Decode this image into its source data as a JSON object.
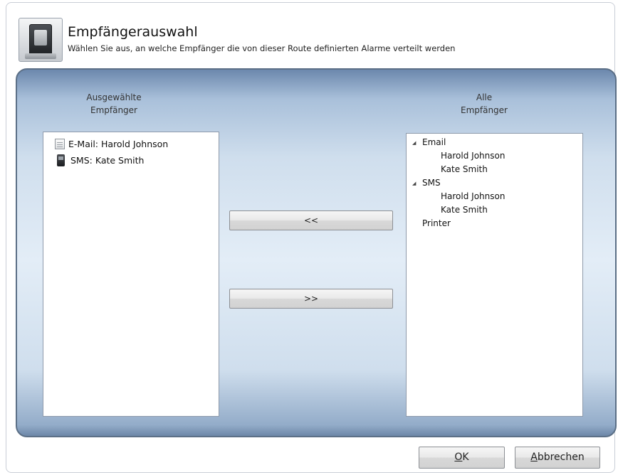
{
  "header": {
    "title": "Empfängerauswahl",
    "subtitle": "Wählen Sie aus, an welche Empfänger die von dieser Route definierten Alarme verteilt werden"
  },
  "selected": {
    "header_line1": "Ausgewählte",
    "header_line2": "Empfänger",
    "items": [
      {
        "label": "E-Mail: Harold Johnson",
        "icon": "email-icon"
      },
      {
        "label": "SMS: Kate Smith",
        "icon": "phone-icon"
      }
    ]
  },
  "all": {
    "header_line1": "Alle",
    "header_line2": "Empfänger",
    "tree": [
      {
        "label": "Email",
        "expanded": true,
        "children": [
          "Harold Johnson",
          "Kate Smith"
        ]
      },
      {
        "label": "SMS",
        "expanded": true,
        "children": [
          "Harold Johnson",
          "Kate Smith"
        ]
      },
      {
        "label": "Printer",
        "expanded": false,
        "children": []
      }
    ]
  },
  "actions": {
    "add_label": "<<",
    "remove_label": ">>"
  },
  "footer": {
    "ok_accel": "O",
    "ok_rest": "K",
    "cancel_accel": "A",
    "cancel_rest": "bbrechen"
  }
}
